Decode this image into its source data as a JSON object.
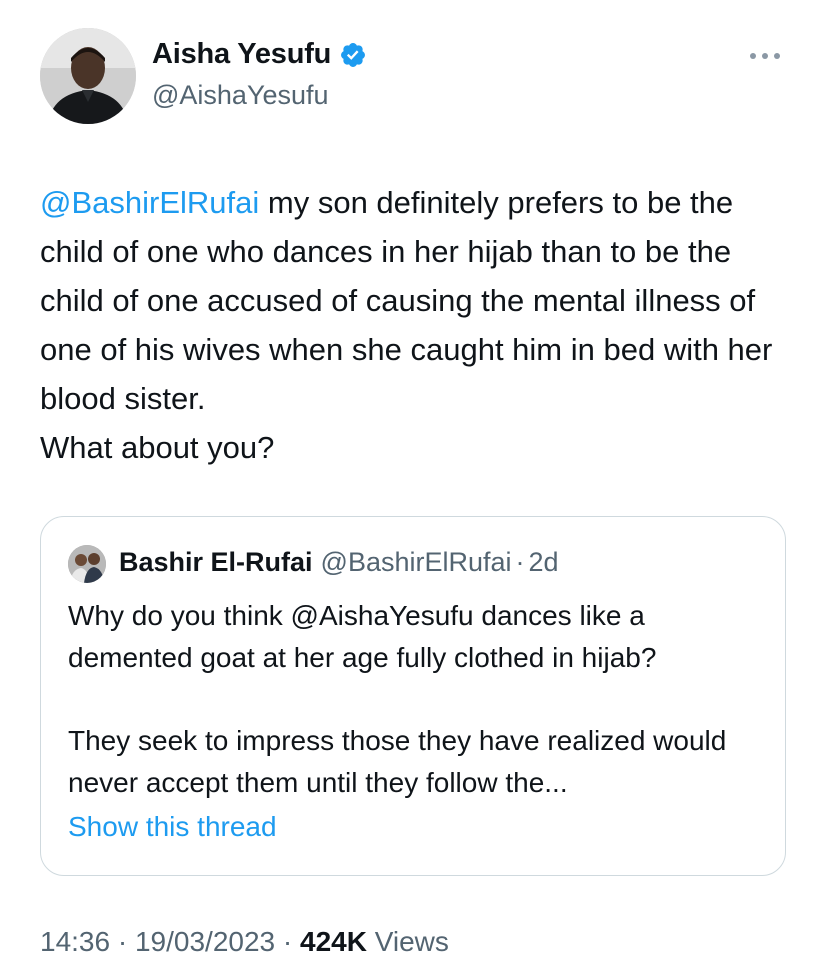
{
  "author": {
    "name": "Aisha Yesufu",
    "handle": "@AishaYesufu"
  },
  "tweet": {
    "mention": "@BashirElRufai",
    "text": " my son definitely prefers to be the child of one who dances in her hijab than to be the child of one accused of causing the mental illness of one of his wives when she caught him in bed with her blood sister.",
    "last_line": "What about you?"
  },
  "quote": {
    "name": "Bashir El-Rufai",
    "handle": "@BashirElRufai",
    "separator": "·",
    "time": "2d",
    "paragraph1": "Why do you think @AishaYesufu dances like a demented goat at her age fully clothed in hijab?",
    "paragraph2": "They seek to impress those they have realized would never accept them until they follow the...",
    "show_thread": "Show this thread"
  },
  "meta": {
    "time": "14:36",
    "separator": "·",
    "date": "19/03/2023",
    "views_count": "424K",
    "views_label": "Views"
  },
  "colors": {
    "accent": "#1d9bf0",
    "secondary_text": "#536471",
    "border": "#cfd9de"
  },
  "icons": {
    "verified": "verified-badge-icon",
    "more": "more-options-icon"
  }
}
